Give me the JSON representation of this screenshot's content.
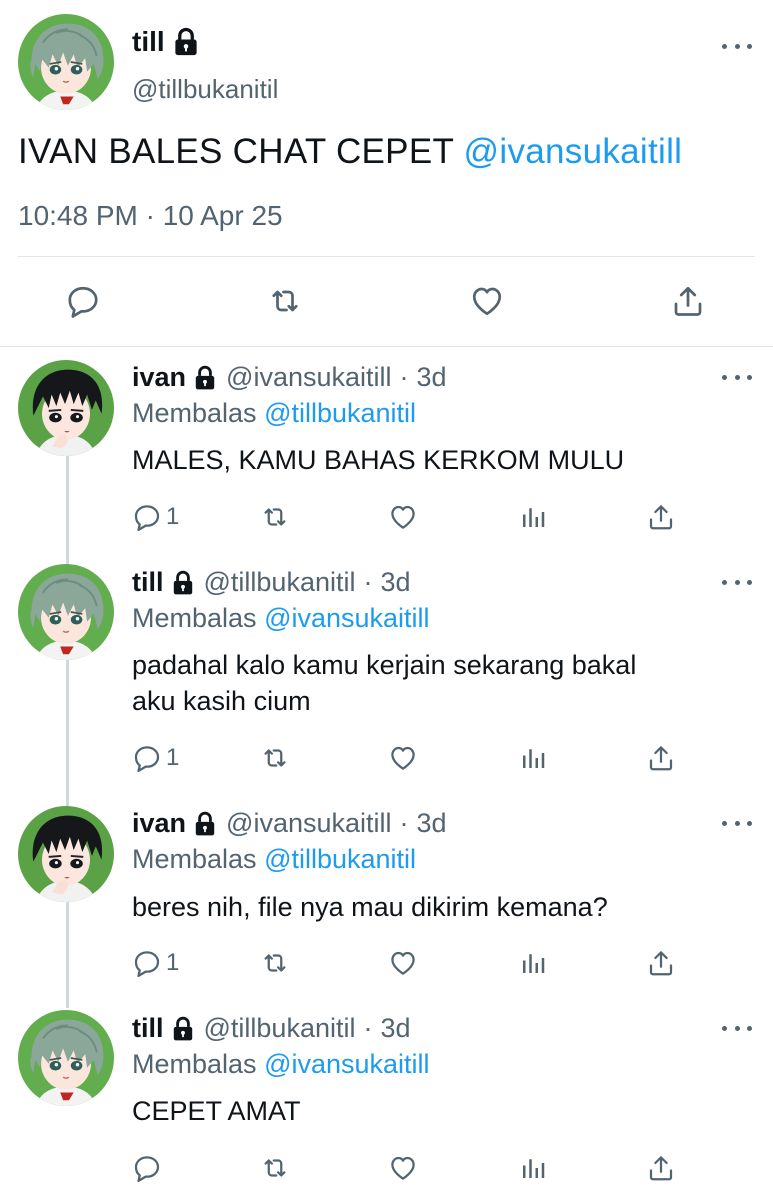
{
  "main_tweet": {
    "name": "till",
    "handle": "@tillbukanitil",
    "text": "IVAN BALES CHAT CEPET",
    "mention": "@ivansukaitill",
    "timestamp": "10:48 PM · 10 Apr 25",
    "icons": [
      "lock-icon",
      "more-icon",
      "reply-icon",
      "retweet-icon",
      "like-icon",
      "share-icon"
    ]
  },
  "replies": [
    {
      "name": "ivan",
      "handle": "@ivansukaitill",
      "dot": "·",
      "ago": "3d",
      "reply_prefix": "Membalas",
      "reply_to": "@tillbukanitil",
      "text": "MALES, KAMU BAHAS KERKOM MULU",
      "reply_count": "1"
    },
    {
      "name": "till",
      "handle": "@tillbukanitil",
      "dot": "·",
      "ago": "3d",
      "reply_prefix": "Membalas",
      "reply_to": "@ivansukaitill",
      "text_line1": "padahal kalo kamu kerjain sekarang bakal",
      "text_line2": "aku kasih cium",
      "reply_count": "1"
    },
    {
      "name": "ivan",
      "handle": "@ivansukaitill",
      "dot": "·",
      "ago": "3d",
      "reply_prefix": "Membalas",
      "reply_to": "@tillbukanitil",
      "text": "beres nih, file nya mau dikirim kemana?",
      "reply_count": "1"
    },
    {
      "name": "till",
      "handle": "@tillbukanitil",
      "dot": "·",
      "ago": "3d",
      "reply_prefix": "Membalas",
      "reply_to": "@ivansukaitill",
      "text": "CEPET AMAT",
      "reply_count": ""
    }
  ],
  "colors": {
    "accent": "#1d9bf0",
    "text": "#0f1419",
    "secondary": "#536471",
    "divider": "#e1e4e8"
  }
}
